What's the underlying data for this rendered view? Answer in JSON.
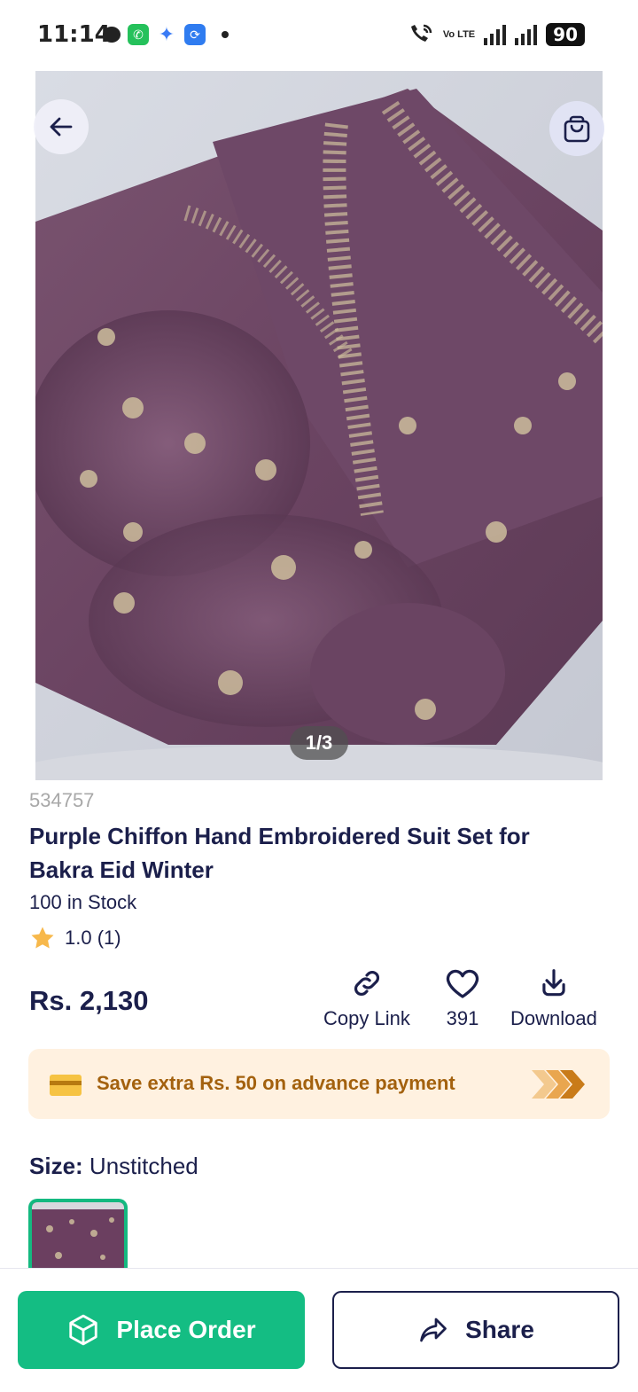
{
  "status_bar": {
    "time": "11:14",
    "battery": "90",
    "network": "Vo LTE"
  },
  "product": {
    "image_pager": "1/3",
    "sku": "534757",
    "title": "Purple Chiffon Hand Embroidered Suit Set for Bakra Eid Winter",
    "stock": "100 in Stock",
    "rating": "1.0 (1)",
    "price": "Rs. 2,130"
  },
  "actions": {
    "copy_link": "Copy Link",
    "likes": "391",
    "download": "Download"
  },
  "promo": {
    "text": "Save extra Rs. 50 on advance payment"
  },
  "size": {
    "label": "Size:",
    "value": "Unstitched"
  },
  "bottom": {
    "place_order": "Place Order",
    "share": "Share"
  },
  "colors": {
    "primary_green": "#14bd83",
    "navy_text": "#1b1f4b",
    "promo_bg": "#fff1e0",
    "promo_text": "#a3610e",
    "product_purple": "#6e4a63"
  },
  "icons": [
    "back-arrow-icon",
    "shopping-bag-icon",
    "star-icon",
    "link-icon",
    "heart-icon",
    "download-icon",
    "credit-card-icon",
    "triple-chevron-icon",
    "box-icon",
    "share-icon"
  ]
}
